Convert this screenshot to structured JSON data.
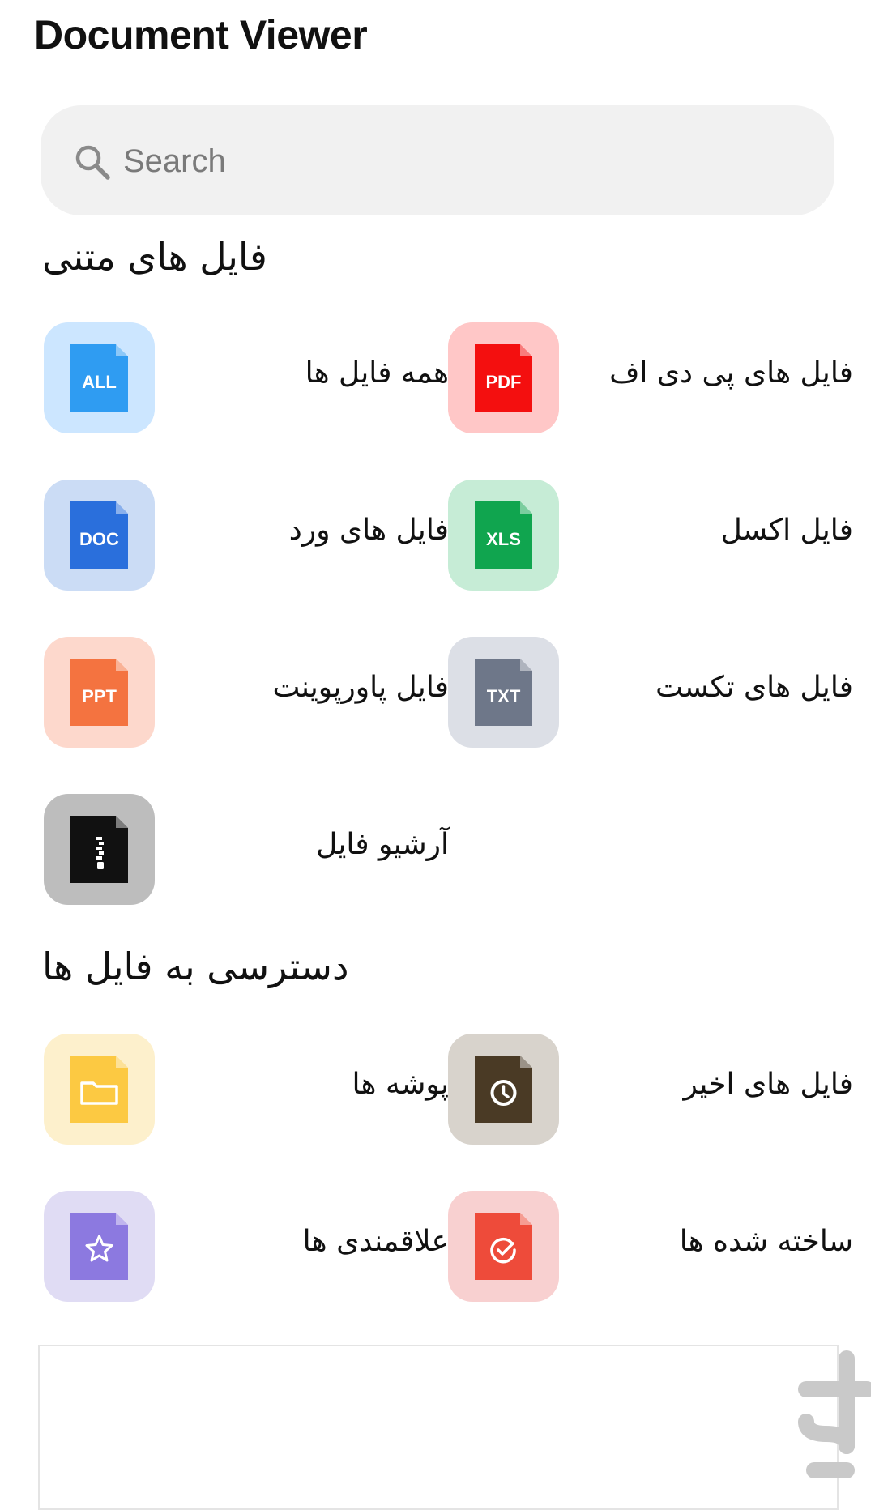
{
  "app": {
    "title": "Document Viewer"
  },
  "search": {
    "placeholder": "Search"
  },
  "sections": {
    "text_files": {
      "title": "فایل های متنی"
    },
    "file_access": {
      "title": "دسترسی به فایل ها"
    }
  },
  "tiles": {
    "pdf": {
      "label": "فایل های پی دی اف",
      "icon_text": "PDF",
      "tile_color": "#ffc7c7",
      "doc_color": "#f40f0f"
    },
    "all": {
      "label": "همه فایل ها",
      "icon_text": "ALL",
      "tile_color": "#cce6ff",
      "doc_color": "#2f9cf2"
    },
    "xls": {
      "label": "فایل اکسل",
      "icon_text": "XLS",
      "tile_color": "#c6ecd6",
      "doc_color": "#10a54f"
    },
    "doc": {
      "label": "فایل های ورد",
      "icon_text": "DOC",
      "tile_color": "#cbdcf5",
      "doc_color": "#2a6fdc"
    },
    "txt": {
      "label": "فایل های تکست",
      "icon_text": "TXT",
      "tile_color": "#dcdfe6",
      "doc_color": "#6e7789"
    },
    "ppt": {
      "label": "فایل پاورپوینت",
      "icon_text": "PPT",
      "tile_color": "#fdd8cc",
      "doc_color": "#f47340"
    },
    "archive": {
      "label": "آرشیو فایل",
      "tile_color": "#bdbdbd",
      "doc_color": "#111111"
    },
    "recent": {
      "label": "فایل های اخیر",
      "tile_color": "#d8d3cc",
      "doc_color": "#4a3a25"
    },
    "folders": {
      "label": "پوشه ها",
      "tile_color": "#fdf0cc",
      "doc_color": "#fcc942"
    },
    "created": {
      "label": "ساخته شده ها",
      "tile_color": "#f8d0d0",
      "doc_color": "#ee4b3a"
    },
    "favorites": {
      "label": "علاقمندی ها",
      "tile_color": "#e0dcf4",
      "doc_color": "#8c79e0"
    }
  }
}
